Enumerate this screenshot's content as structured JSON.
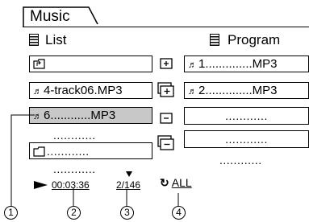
{
  "tab": {
    "label": "Music"
  },
  "headers": {
    "list": "List",
    "program": "Program"
  },
  "list_rows": [
    {
      "text": "",
      "icon": "folder-up-icon"
    },
    {
      "text": "4-track06.MP3",
      "icon": "note-icon"
    },
    {
      "text": "6............MP3",
      "icon": "note-icon",
      "selected": true
    },
    {
      "text": "............",
      "icon": ""
    },
    {
      "text": "............",
      "icon": "folder-icon"
    },
    {
      "text": "............",
      "icon": ""
    }
  ],
  "program_rows": [
    {
      "text": "1..............MP3",
      "icon": "note-icon"
    },
    {
      "text": "2..............MP3",
      "icon": "note-icon"
    },
    {
      "text": "............",
      "icon": ""
    },
    {
      "text": "............",
      "icon": ""
    },
    {
      "text": "............",
      "icon": ""
    }
  ],
  "status": {
    "time": "00:03:36",
    "track": "2/146",
    "repeat": "ALL"
  },
  "callouts": [
    "1",
    "2",
    "3",
    "4"
  ]
}
